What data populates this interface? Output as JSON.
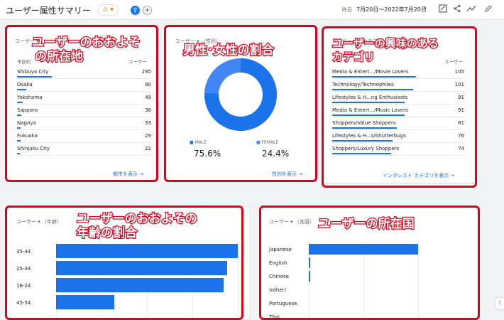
{
  "header": {
    "title": "ユーザー属性サマリー",
    "warning_symbol": "⚠ ▾",
    "avatar_letter": "す",
    "add_symbol": "+",
    "date_caption": "昨日",
    "date_range": "7月20日～2022年7月20日",
    "caret": "▾",
    "icons": [
      "chart-edit-icon",
      "share-icon",
      "insights-icon",
      "pencil-icon"
    ]
  },
  "city_card": {
    "caption": "ユーザー ▾",
    "col_left": "市区町",
    "col_right": "ユーザー",
    "rows": [
      {
        "label": "Shibuya City",
        "value": 295
      },
      {
        "label": "Osaka",
        "value": 80
      },
      {
        "label": "Yokohama",
        "value": 49
      },
      {
        "label": "Sapporo",
        "value": 38
      },
      {
        "label": "Nagoya",
        "value": 33
      },
      {
        "label": "Fukuoka",
        "value": 29
      },
      {
        "label": "Shinjuku City",
        "value": 22
      }
    ],
    "link": "都市を表示",
    "annotation_line1": "ユーザーのおおよそ",
    "annotation_line2": "の所在地"
  },
  "gender_card": {
    "caption": "ユーザー ▾ （性別）",
    "male_label": "MALE",
    "male_value": "75.6%",
    "female_label": "FEMALE",
    "female_value": "24.4%",
    "male_fraction": 0.756,
    "link": "性別を表示",
    "annotation": "男性･女性の割合",
    "colors": {
      "male": "#1a73e8",
      "female": "#4285f4"
    }
  },
  "interest_card": {
    "caption": "ユーザー ▾ （カテゴリ）",
    "col_right": "ユーザー",
    "rows": [
      {
        "label": "Media & Entert.../Movie Lovers",
        "value": 105
      },
      {
        "label": "Technology/Technophiles",
        "value": 101
      },
      {
        "label": "Lifestyles & H...ng Enthusiasts",
        "value": 91
      },
      {
        "label": "Media & Entert.../Music Lovers",
        "value": 91
      },
      {
        "label": "Shoppers/Value Shoppers",
        "value": 81
      },
      {
        "label": "Lifestyles & H...s/Shutterbugs",
        "value": 76
      },
      {
        "label": "Shoppers/Luxury Shoppers",
        "value": 74
      }
    ],
    "link": "インタレスト カテゴリを表示",
    "annotation_line1": "ユーザーの興味のある",
    "annotation_line2": "カテゴリ"
  },
  "age_card": {
    "caption": "ユーザー ▾ （年齢）",
    "annotation_line1": "ユーザーのおおよその",
    "annotation_line2": "年齢の割合"
  },
  "country_card": {
    "caption": "ユーザー ▾ （言語）",
    "annotation": "ユーザーの所在国"
  },
  "feedback_icon": "feedback-icon",
  "chart_data": [
    {
      "type": "bar",
      "categories": [
        "35-44",
        "25-34",
        "18-24",
        "45-54"
      ],
      "values": [
        100,
        94,
        92,
        32
      ],
      "title": "",
      "xlabel": "",
      "ylabel": "",
      "xlim": [
        0,
        100
      ]
    },
    {
      "type": "bar",
      "categories": [
        "Japanese",
        "English",
        "Chinese",
        "(other)",
        "Portuguese",
        "Thai"
      ],
      "values": [
        100,
        1,
        1,
        0,
        0,
        0
      ],
      "title": "",
      "xlabel": "",
      "ylabel": "",
      "xlim": [
        0,
        100
      ]
    }
  ]
}
